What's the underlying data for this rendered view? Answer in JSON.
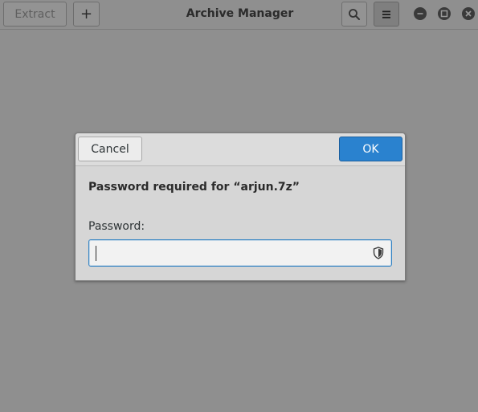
{
  "headerbar": {
    "extract_label": "Extract",
    "add_label": "+",
    "title": "Archive Manager"
  },
  "dialog": {
    "cancel_label": "Cancel",
    "ok_label": "OK",
    "message": "Password required for “arjun.7z”",
    "password_label": "Password:",
    "password_value": ""
  },
  "icons": {
    "search": "search-icon",
    "menu": "hamburger-menu-icon",
    "minimize": "minimize-icon",
    "maximize": "maximize-icon",
    "close": "close-icon",
    "caps_lock": "shield-icon"
  },
  "colors": {
    "accent": "#2a82cf",
    "backdrop": "#8f8f8f"
  }
}
